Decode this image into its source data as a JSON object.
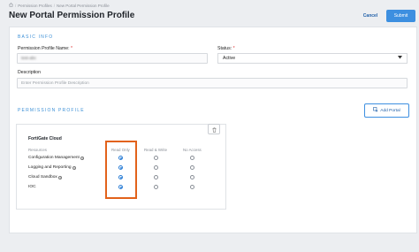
{
  "breadcrumb": {
    "home_icon": "home-icon",
    "item1": "Permission Profiles",
    "item2": "New Portal Permission Profile"
  },
  "header": {
    "title": "New Portal Permission Profile",
    "cancel_label": "Cancel",
    "submit_label": "Submit"
  },
  "basic_info": {
    "heading": "BASIC INFO",
    "name_label": "Permission Profile Name:",
    "name_value": "test-abc",
    "status_label": "Status:",
    "status_value": "Active",
    "description_label": "Description",
    "description_placeholder": "Enter Permission Profile Description",
    "required_mark": "*"
  },
  "permission_profile": {
    "heading": "PERMISSION PROFILE",
    "add_portal_label": "Add Portal",
    "card": {
      "title": "FortiGate Cloud",
      "columns": [
        "Resources",
        "Read Only",
        "Read & Write",
        "No Access"
      ],
      "rows": [
        {
          "resource": "Configuration Management",
          "selected": "Read Only"
        },
        {
          "resource": "Logging and Reporting",
          "selected": "Read Only"
        },
        {
          "resource": "Cloud Sandbox",
          "selected": "Read Only"
        },
        {
          "resource": "IOC",
          "selected": "Read Only"
        }
      ]
    }
  },
  "colors": {
    "accent": "#3d8fe0",
    "highlight": "#e2621b"
  }
}
